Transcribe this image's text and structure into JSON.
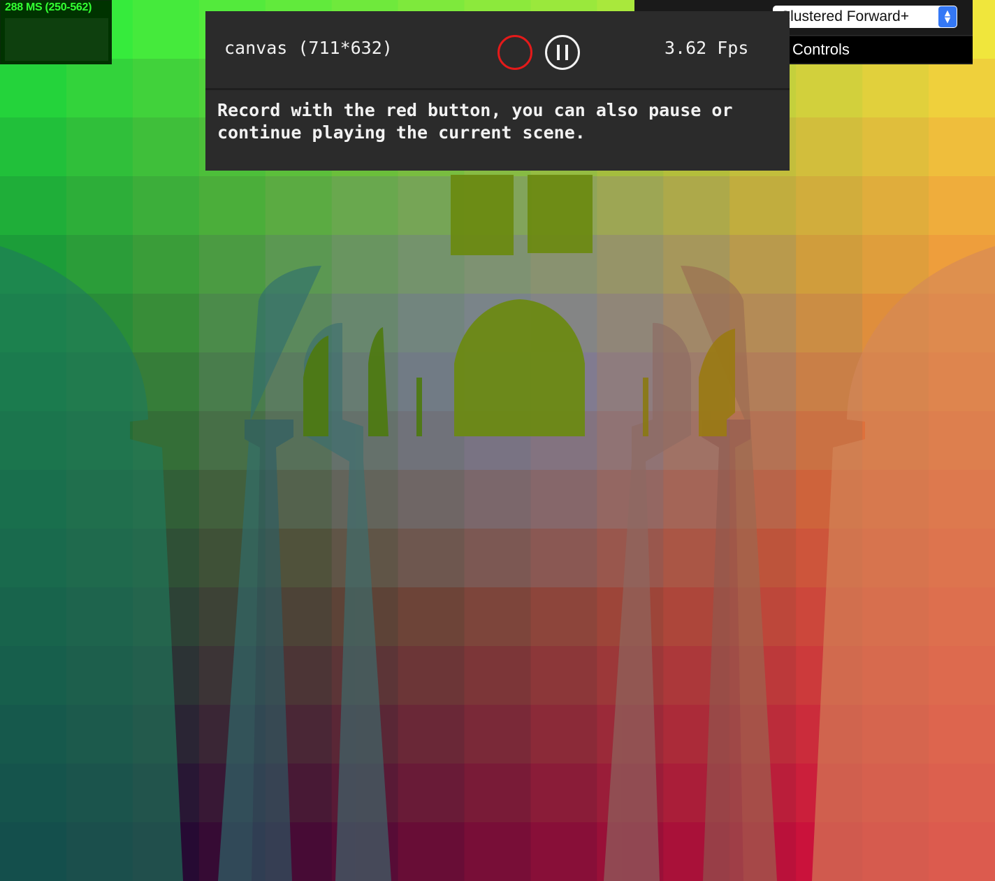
{
  "stats": {
    "frame_time": "288 MS (250-562)"
  },
  "renderer": {
    "selected": "Clustered Forward+",
    "arrows_icon": "up-down-chevron-icon",
    "controls_label": "Controls"
  },
  "recorder": {
    "canvas_label": "canvas (711*632)",
    "record_icon": "record-circle-icon",
    "pause_icon": "pause-icon",
    "fps": "3.62 Fps",
    "help_text": "Record with the red button, you can also pause or continue playing the current scene."
  },
  "colors": {
    "stats_text": "#33ff33",
    "record": "#e41a1a",
    "select_arrow": "#3478f6"
  }
}
